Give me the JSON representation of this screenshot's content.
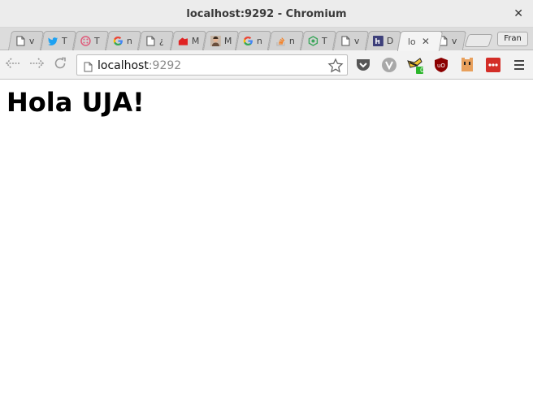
{
  "window": {
    "title": "localhost:9292 - Chromium",
    "close_glyph": "✕"
  },
  "tabs": [
    {
      "icon": "page-icon",
      "title": "v"
    },
    {
      "icon": "twitter-icon",
      "title": "T"
    },
    {
      "icon": "dots-circle-icon",
      "title": "T"
    },
    {
      "icon": "google-icon",
      "title": "n"
    },
    {
      "icon": "page-icon",
      "title": "¿"
    },
    {
      "icon": "red-logo-icon",
      "title": "M"
    },
    {
      "icon": "avatar-icon",
      "title": "M"
    },
    {
      "icon": "google-icon",
      "title": "n"
    },
    {
      "icon": "stackoverflow-icon",
      "title": "n"
    },
    {
      "icon": "hexagon-logo-icon",
      "title": "T"
    },
    {
      "icon": "page-icon",
      "title": "v"
    },
    {
      "icon": "square-h-icon",
      "title": "D"
    },
    {
      "icon": "none",
      "title": "lo",
      "active": true,
      "close": "✕"
    },
    {
      "icon": "page-icon",
      "title": "v"
    }
  ],
  "profile": {
    "label": "Fran"
  },
  "omnibox": {
    "host": "localhost",
    "port": ":9292"
  },
  "extensions": [
    "pocket-icon",
    "vivaldi-like-icon",
    "badger-icon",
    "ublock-icon",
    "monster-icon",
    "lastpass-icon",
    "menu-icon"
  ],
  "extension_badges": {
    "badger": "0"
  },
  "page": {
    "heading": "Hola UJA!"
  },
  "colors": {
    "twitter": "#1da1f2",
    "google_blue": "#4285f4",
    "ublock": "#8b0000",
    "lastpass": "#d32d27",
    "badge_green": "#2ab52a"
  }
}
